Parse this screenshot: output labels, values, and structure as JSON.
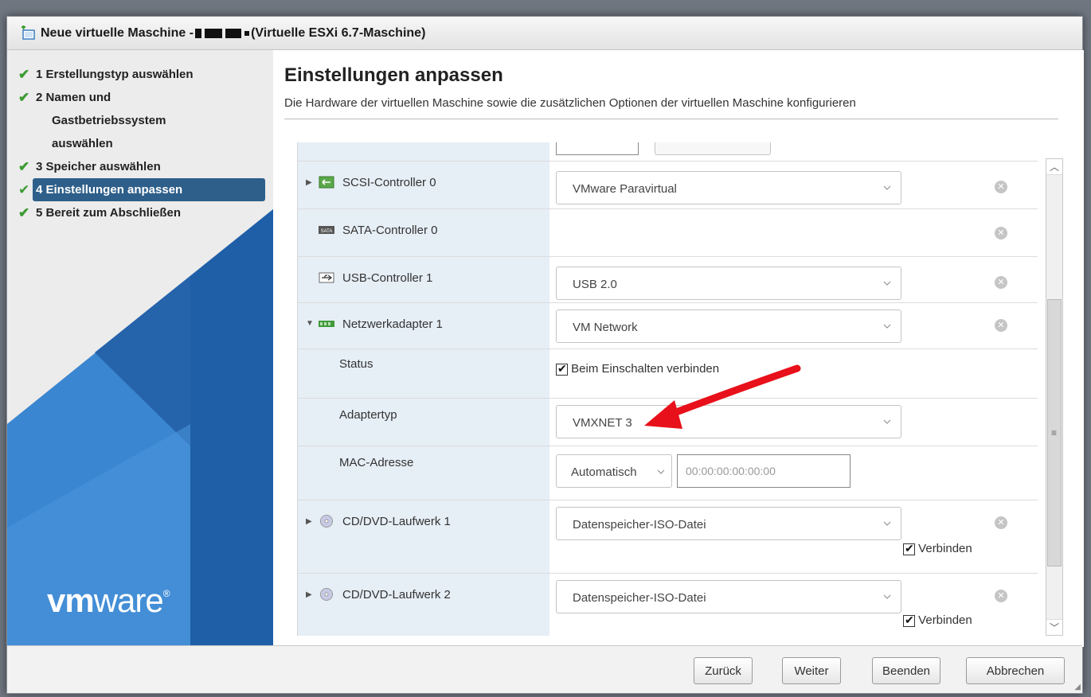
{
  "dialog": {
    "title_prefix": "Neue virtuelle Maschine -",
    "title_suffix": "(Virtuelle ESXi 6.7-Maschine)"
  },
  "sidebar": {
    "steps": [
      {
        "label": "1 Erstellungstyp auswählen"
      },
      {
        "label": "2 Namen und"
      },
      {
        "label": "Gastbetriebssystem"
      },
      {
        "label": "auswählen"
      },
      {
        "label": "3 Speicher auswählen"
      },
      {
        "label": "4 Einstellungen anpassen"
      },
      {
        "label": "5 Bereit zum Abschließen"
      }
    ],
    "logo_bold": "vm",
    "logo_light": "ware",
    "logo_mark": "®"
  },
  "main": {
    "title": "Einstellungen anpassen",
    "subtitle": "Die Hardware der virtuellen Maschine sowie die zusätzlichen Optionen der virtuellen Maschine konfigurieren"
  },
  "hardware": {
    "scsi": {
      "label": "SCSI-Controller 0",
      "value": "VMware Paravirtual"
    },
    "sata": {
      "label": "SATA-Controller 0"
    },
    "usb": {
      "label": "USB-Controller 1",
      "value": "USB 2.0"
    },
    "network": {
      "label": "Netzwerkadapter 1",
      "value": "VM Network",
      "status_label": "Status",
      "status_checkbox": "Beim Einschalten verbinden",
      "adapter_label": "Adaptertyp",
      "adapter_value": "VMXNET 3",
      "mac_label": "MAC-Adresse",
      "mac_mode": "Automatisch",
      "mac_placeholder": "00:00:00:00:00:00"
    },
    "cd1": {
      "label": "CD/DVD-Laufwerk 1",
      "value": "Datenspeicher-ISO-Datei",
      "connect": "Verbinden"
    },
    "cd2": {
      "label": "CD/DVD-Laufwerk 2",
      "value": "Datenspeicher-ISO-Datei",
      "connect": "Verbinden"
    }
  },
  "footer": {
    "back": "Zurück",
    "next": "Weiter",
    "finish": "Beenden",
    "cancel": "Abbrechen"
  },
  "colors": {
    "accent": "#2e5f8a",
    "check_green": "#3c9b32",
    "annotation_arrow": "#e8101a"
  }
}
